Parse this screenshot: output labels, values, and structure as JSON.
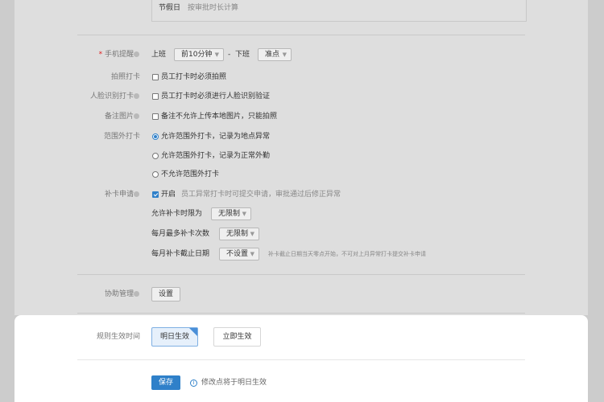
{
  "holiday": {
    "label": "节假日",
    "desc": "按审批时长计算"
  },
  "phone_reminder": {
    "required_mark": "*",
    "label": "手机提醒",
    "on_duty": "上班",
    "on_duty_value": "前10分钟",
    "dash": "-",
    "off_duty": "下班",
    "off_duty_value": "准点"
  },
  "photo_punch": {
    "label": "拍照打卡",
    "option": "员工打卡时必须拍照",
    "checked": false
  },
  "face_punch": {
    "label": "人脸识别打卡",
    "option": "员工打卡时必须进行人脸识别验证",
    "checked": false
  },
  "remark_photo": {
    "label": "备注图片",
    "option": "备注不允许上传本地图片，只能拍照",
    "checked": false
  },
  "out_of_range": {
    "label": "范围外打卡",
    "options": [
      "允许范围外打卡，记录为地点异常",
      "允许范围外打卡，记录为正常外勤",
      "不允许范围外打卡"
    ],
    "selected_index": 0
  },
  "makeup": {
    "label": "补卡申请",
    "enabled_label": "开启",
    "enabled_desc": "员工异常打卡时可提交申请，审批通过后修正异常",
    "enabled": true,
    "time_limit_label": "允许补卡时限为",
    "time_limit_value": "无限制",
    "monthly_max_label": "每月最多补卡次数",
    "monthly_max_value": "无限制",
    "deadline_label": "每月补卡截止日期",
    "deadline_value": "不设置",
    "deadline_hint": "补卡截止日期当天零点开始，不可对上月异常打卡提交补卡申请"
  },
  "assist": {
    "label": "协助管理",
    "button": "设置"
  },
  "effective": {
    "label": "规则生效时间",
    "options": [
      "明日生效",
      "立即生效"
    ],
    "selected_index": 0
  },
  "footer": {
    "save": "保存",
    "info_icon": "i",
    "hint": "修改点将于明日生效"
  },
  "colors": {
    "primary": "#2f80c9",
    "required": "#e02020"
  },
  "icons": {
    "info": "info-icon",
    "dropdown": "chevron-down-icon",
    "checkbox": "checkbox",
    "radio": "radio-button"
  }
}
